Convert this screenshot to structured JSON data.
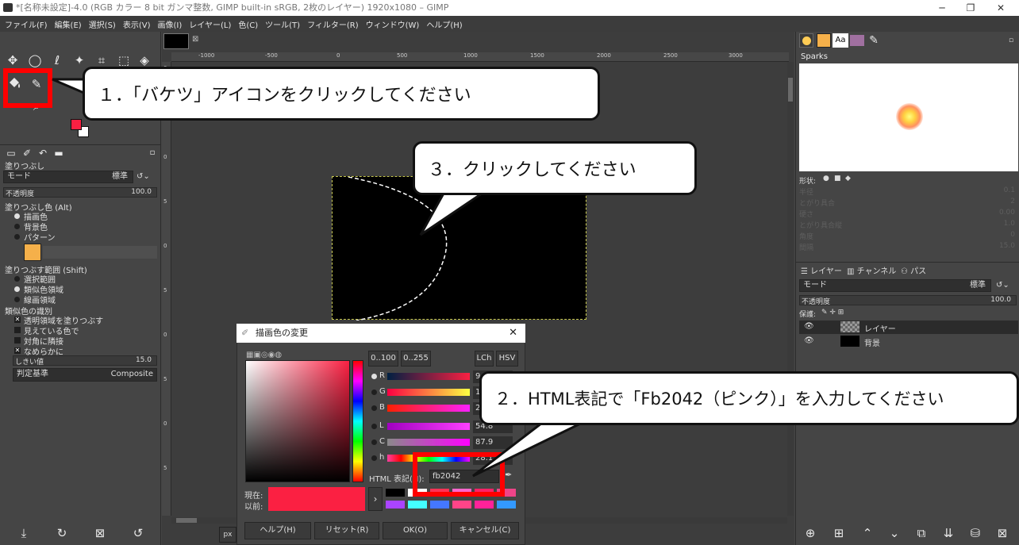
{
  "window": {
    "title": "*[名称未設定]-4.0 (RGB カラー 8 bit ガンマ整数, GIMP built-in sRGB, 2枚のレイヤー) 1920x1080 – GIMP",
    "minimize": "─",
    "maximize": "❐",
    "close": "✕"
  },
  "menu": [
    "ファイル(F)",
    "編集(E)",
    "選択(S)",
    "表示(V)",
    "画像(I)",
    "レイヤー(L)",
    "色(C)",
    "ツール(T)",
    "フィルター(R)",
    "ウィンドウ(W)",
    "ヘルプ(H)"
  ],
  "tool_options": {
    "title": "塗りつぶし",
    "mode_label": "モード",
    "mode_value": "標準",
    "opacity_label": "不透明度",
    "opacity_value": "100.0",
    "fill_color_label": "塗りつぶし色 (Alt)",
    "fill_fg": "描画色",
    "fill_bg": "背景色",
    "fill_pattern": "パターン",
    "fill_area_label": "塗りつぶす範囲 (Shift)",
    "area_selection": "選択範囲",
    "area_similar": "類似色領域",
    "area_line": "線画領域",
    "similar_label": "類似色の識別",
    "opt_transparent": "透明領域を塗りつぶす",
    "opt_visible": "見えている色で",
    "opt_diagonal": "対角に隣接",
    "opt_smooth": "なめらかに",
    "threshold_label": "しきい値",
    "threshold_value": "15.0",
    "criterion_label": "判定基準",
    "criterion_value": "Composite"
  },
  "ruler": {
    "ticks": [
      "-1000",
      "-500",
      "0",
      "500",
      "1000",
      "1500",
      "2000",
      "2500",
      "3000"
    ],
    "vticks": [
      "0",
      "5",
      "0",
      "5",
      "0",
      "5",
      "0",
      "5",
      "0",
      "5"
    ]
  },
  "unit": "px",
  "brush_panel": {
    "brush_name": "Sparks",
    "shape_label": "形状:",
    "params": [
      "半径",
      "とがり具合",
      "硬さ",
      "とがり具合縦",
      "角度",
      "間隔"
    ],
    "param_values": [
      "0.1",
      "2",
      "0.00",
      "1.0",
      "0",
      "15.0"
    ]
  },
  "layers_panel": {
    "tab_layers": "レイヤー",
    "tab_channels": "チャンネル",
    "tab_paths": "パス",
    "mode_label": "モード",
    "mode_value": "標準",
    "opacity_label": "不透明度",
    "opacity_value": "100.0",
    "lock_label": "保護:",
    "layers": [
      {
        "name": "レイヤー"
      },
      {
        "name": "背景"
      }
    ]
  },
  "color_dialog": {
    "title": "描画色の変更",
    "range_100": "0..100",
    "range_255": "0..255",
    "lch": "LCh",
    "hsv": "HSV",
    "channels": [
      {
        "label": "R",
        "value": "9"
      },
      {
        "label": "G",
        "value": "1"
      },
      {
        "label": "B",
        "value": "2"
      },
      {
        "label": "L",
        "value": "54.8"
      },
      {
        "label": "C",
        "value": "87.9"
      },
      {
        "label": "h",
        "value": "28.1"
      }
    ],
    "html_label": "HTML 表記(N):",
    "html_value": "fb2042",
    "current_label": "現在:",
    "previous_label": "以前:",
    "help": "ヘルプ(H)",
    "reset": "リセット(R)",
    "ok": "OK(O)",
    "cancel": "キャンセル(C)",
    "current_color": "#fb2042"
  },
  "callouts": {
    "step1": "１．「バケツ」アイコンをクリックしてください",
    "step2": "２．HTML表記で「Fb2042（ピンク）」を入力してください",
    "step3": "３．クリックしてください"
  },
  "colors": {
    "foreground": "#fb2042",
    "background": "#ffffff",
    "highlight": "#ff0000"
  }
}
